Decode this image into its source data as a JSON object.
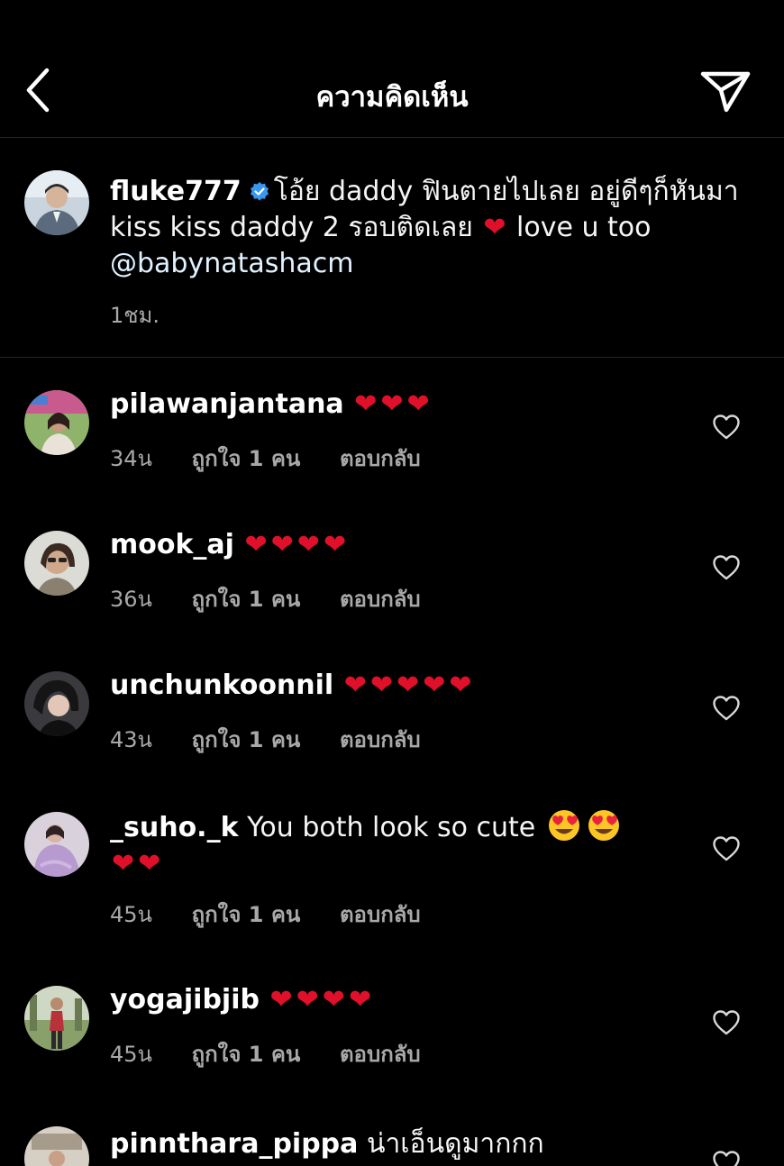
{
  "header": {
    "title": "ความคิดเห็น",
    "back_icon": "chevron-left-icon",
    "share_icon": "paper-plane-icon"
  },
  "caption": {
    "username": "fluke777",
    "verified": true,
    "text_part1": "โอ้ย daddy ฟินตายไปเลย อยู่ดีๆก็หันมา kiss kiss daddy 2 รอบติดเลย",
    "text_part2": "love u too",
    "mention": "@babynatashacm",
    "time": "1ชม."
  },
  "comments": [
    {
      "username": "pilawanjantana",
      "text": "",
      "hearts": 3,
      "time": "34น",
      "likes": "ถูกใจ 1 คน",
      "reply": "ตอบกลับ"
    },
    {
      "username": "mook_aj",
      "text": "",
      "hearts": 4,
      "time": "36น",
      "likes": "ถูกใจ 1 คน",
      "reply": "ตอบกลับ"
    },
    {
      "username": "unchunkoonnil",
      "text": "",
      "hearts": 5,
      "time": "43น",
      "likes": "ถูกใจ 1 คน",
      "reply": "ตอบกลับ"
    },
    {
      "username": "_suho._k",
      "text": "You both look so cute",
      "hearts": 2,
      "time": "45น",
      "likes": "ถูกใจ 1 คน",
      "reply": "ตอบกลับ"
    },
    {
      "username": "yogajibjib",
      "text": "",
      "hearts": 4,
      "time": "45น",
      "likes": "ถูกใจ 1 คน",
      "reply": "ตอบกลับ"
    },
    {
      "username": "pinnthara_pippa",
      "text": "น่าเอ็นดูมากกก",
      "hearts": 0
    }
  ],
  "colors": {
    "background": "#000000",
    "text": "#f5f5f5",
    "secondary_text": "#a8a8a8",
    "verified_badge": "#3897f0",
    "heart_emoji": "#e0102a",
    "divider": "#262626"
  },
  "icons": {
    "like": "heart-outline-icon",
    "verified": "verified-badge-icon",
    "emoji_heart": "red-heart-emoji",
    "emoji_smiley": "heart-eyes-emoji"
  }
}
